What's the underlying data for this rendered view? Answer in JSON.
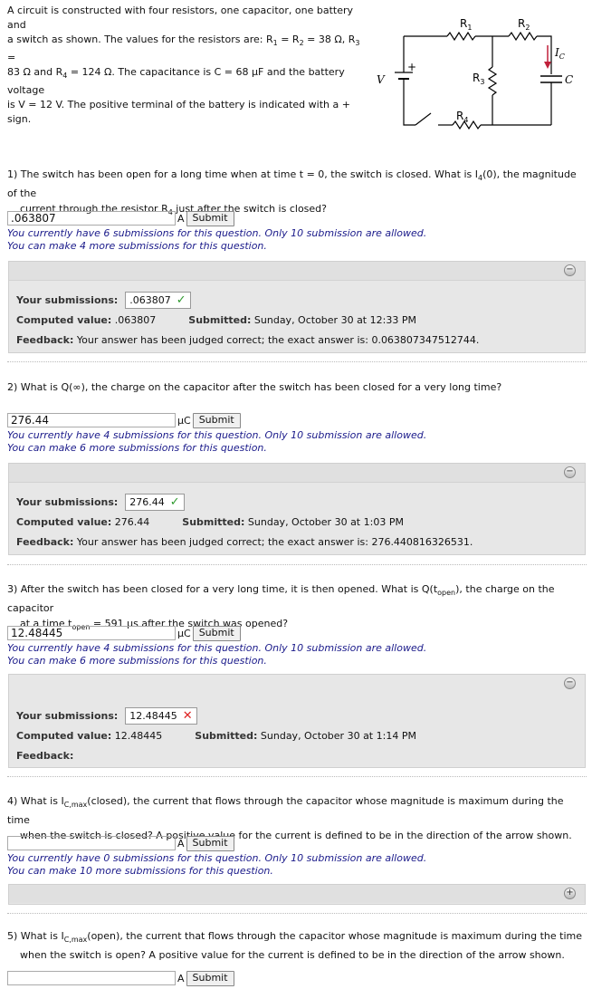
{
  "intro": {
    "l1": "A circuit is constructed with four resistors, one capacitor, one battery and",
    "l2": "a switch as shown. The values for the resistors are: R",
    "l2b": "1",
    "l2c": " = R",
    "l2d": "2",
    "l2e": " = 38 Ω, R",
    "l2f": "3",
    "l2g": " =",
    "l3": "83 Ω and R",
    "l3b": "4",
    "l3c": " = 124 Ω. The capacitance is C = 68 μF and the battery voltage",
    "l4": "is V = 12 V. The positive terminal of the battery is indicated with a + sign."
  },
  "circuit": {
    "R1": "R",
    "R1s": "1",
    "R2": "R",
    "R2s": "2",
    "R3": "R",
    "R3s": "3",
    "R4": "R",
    "R4s": "4",
    "V": "V",
    "plus": "+",
    "Ic": "I",
    "Ics": "C",
    "C": "C",
    "wire_color": "#000000",
    "arrow_color": "#c0203a"
  },
  "q1": {
    "line1": "1) The switch has been open for a long time when at time t = 0, the switch is closed. What is I",
    "line1_sub": "4",
    "line1_end": "(0), the magnitude of the",
    "line2": "current through the resistor R",
    "line2_sub": "4",
    "line2_end": " just after the switch is closed?",
    "answer": ".063807",
    "unit": "A",
    "submit": "Submit",
    "note1": "You currently have 6 submissions for this question. Only 10 submission are allowed.",
    "note2": "You can make 4 more submissions for this question.",
    "your_label": "Your submissions:",
    "your_value": ".063807",
    "computed_label": "Computed value:",
    "computed_value": ".063807",
    "submitted_label": "Submitted:",
    "submitted_value": "Sunday, October 30 at 12:33 PM",
    "feedback_label": "Feedback:",
    "feedback_value": "Your answer has been judged correct; the exact answer is: 0.063807347512744."
  },
  "q2": {
    "line1": "2) What is Q(∞), the charge on the capacitor after the switch has been closed for a very long time?",
    "answer": "276.44",
    "unit": "μC",
    "submit": "Submit",
    "note1": "You currently have 4 submissions for this question. Only 10 submission are allowed.",
    "note2": "You can make 6 more submissions for this question.",
    "your_label": "Your submissions:",
    "your_value": "276.44",
    "computed_label": "Computed value:",
    "computed_value": "276.44",
    "submitted_label": "Submitted:",
    "submitted_value": "Sunday, October 30 at 1:03 PM",
    "feedback_label": "Feedback:",
    "feedback_value": "Your answer has been judged correct; the exact answer is: 276.440816326531."
  },
  "q3": {
    "line1": "3) After the switch has been closed for a very long time, it is then opened. What is Q(t",
    "line1_sub": "open",
    "line1_end": "), the charge on the capacitor",
    "line2": "at a time t",
    "line2_sub": "open",
    "line2_end": " = 591 μs after the switch was opened?",
    "answer": "12.48445",
    "unit": "μC",
    "submit": "Submit",
    "note1": "You currently have 4 submissions for this question. Only 10 submission are allowed.",
    "note2": "You can make 6 more submissions for this question.",
    "your_label": "Your submissions:",
    "your_value": "12.48445",
    "computed_label": "Computed value:",
    "computed_value": "12.48445",
    "submitted_label": "Submitted:",
    "submitted_value": "Sunday, October 30 at 1:14 PM",
    "feedback_label": "Feedback:"
  },
  "q4": {
    "line1": "4) What is I",
    "line1_sub": "C,max",
    "line1_end": "(closed), the current that flows through the capacitor whose magnitude is maximum during the time",
    "line2": "when the switch is closed? A positive value for the current is defined to be in the direction of the arrow shown.",
    "answer": "",
    "unit": "A",
    "submit": "Submit",
    "note1": "You currently have 0 submissions for this question. Only 10 submission are allowed.",
    "note2": "You can make 10 more submissions for this question."
  },
  "q5": {
    "line1": "5) What is I",
    "line1_sub": "C,max",
    "line1_end": "(open), the current that flows through the capacitor whose magnitude is maximum during the time",
    "line2": "when the switch is open? A positive value for the current is defined to be in the direction of the arrow shown.",
    "answer": "",
    "unit": "A",
    "submit": "Submit"
  },
  "icons": {
    "collapse": "−",
    "expand": "+",
    "check": "✓",
    "cross": "✕"
  }
}
